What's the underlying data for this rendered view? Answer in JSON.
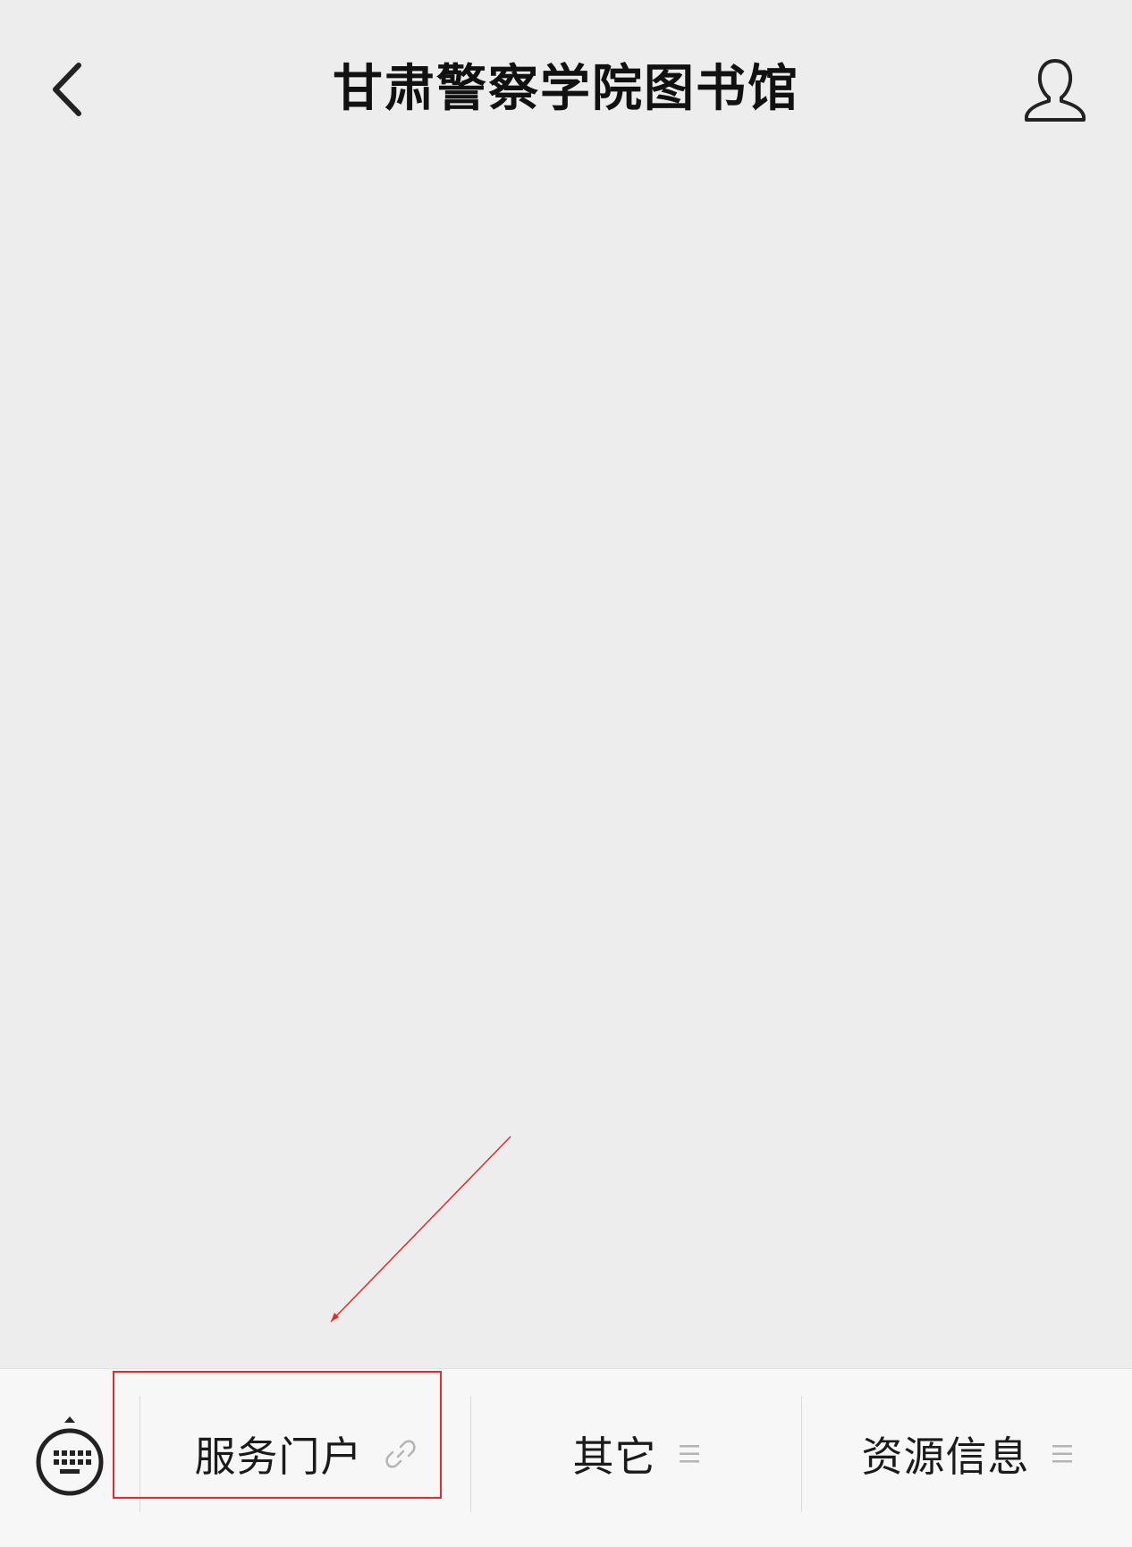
{
  "header": {
    "title": "甘肃警察学院图书馆",
    "back_icon": "chevron-left-icon",
    "profile_icon": "user-icon"
  },
  "menu": {
    "keyboard_icon": "keyboard-icon",
    "items": [
      {
        "label": "服务门户",
        "icon": "link-icon"
      },
      {
        "label": "其它",
        "icon": "menu-lines-icon"
      },
      {
        "label": "资源信息",
        "icon": "menu-lines-icon"
      }
    ]
  },
  "annotation": {
    "color": "#e42a2a"
  }
}
